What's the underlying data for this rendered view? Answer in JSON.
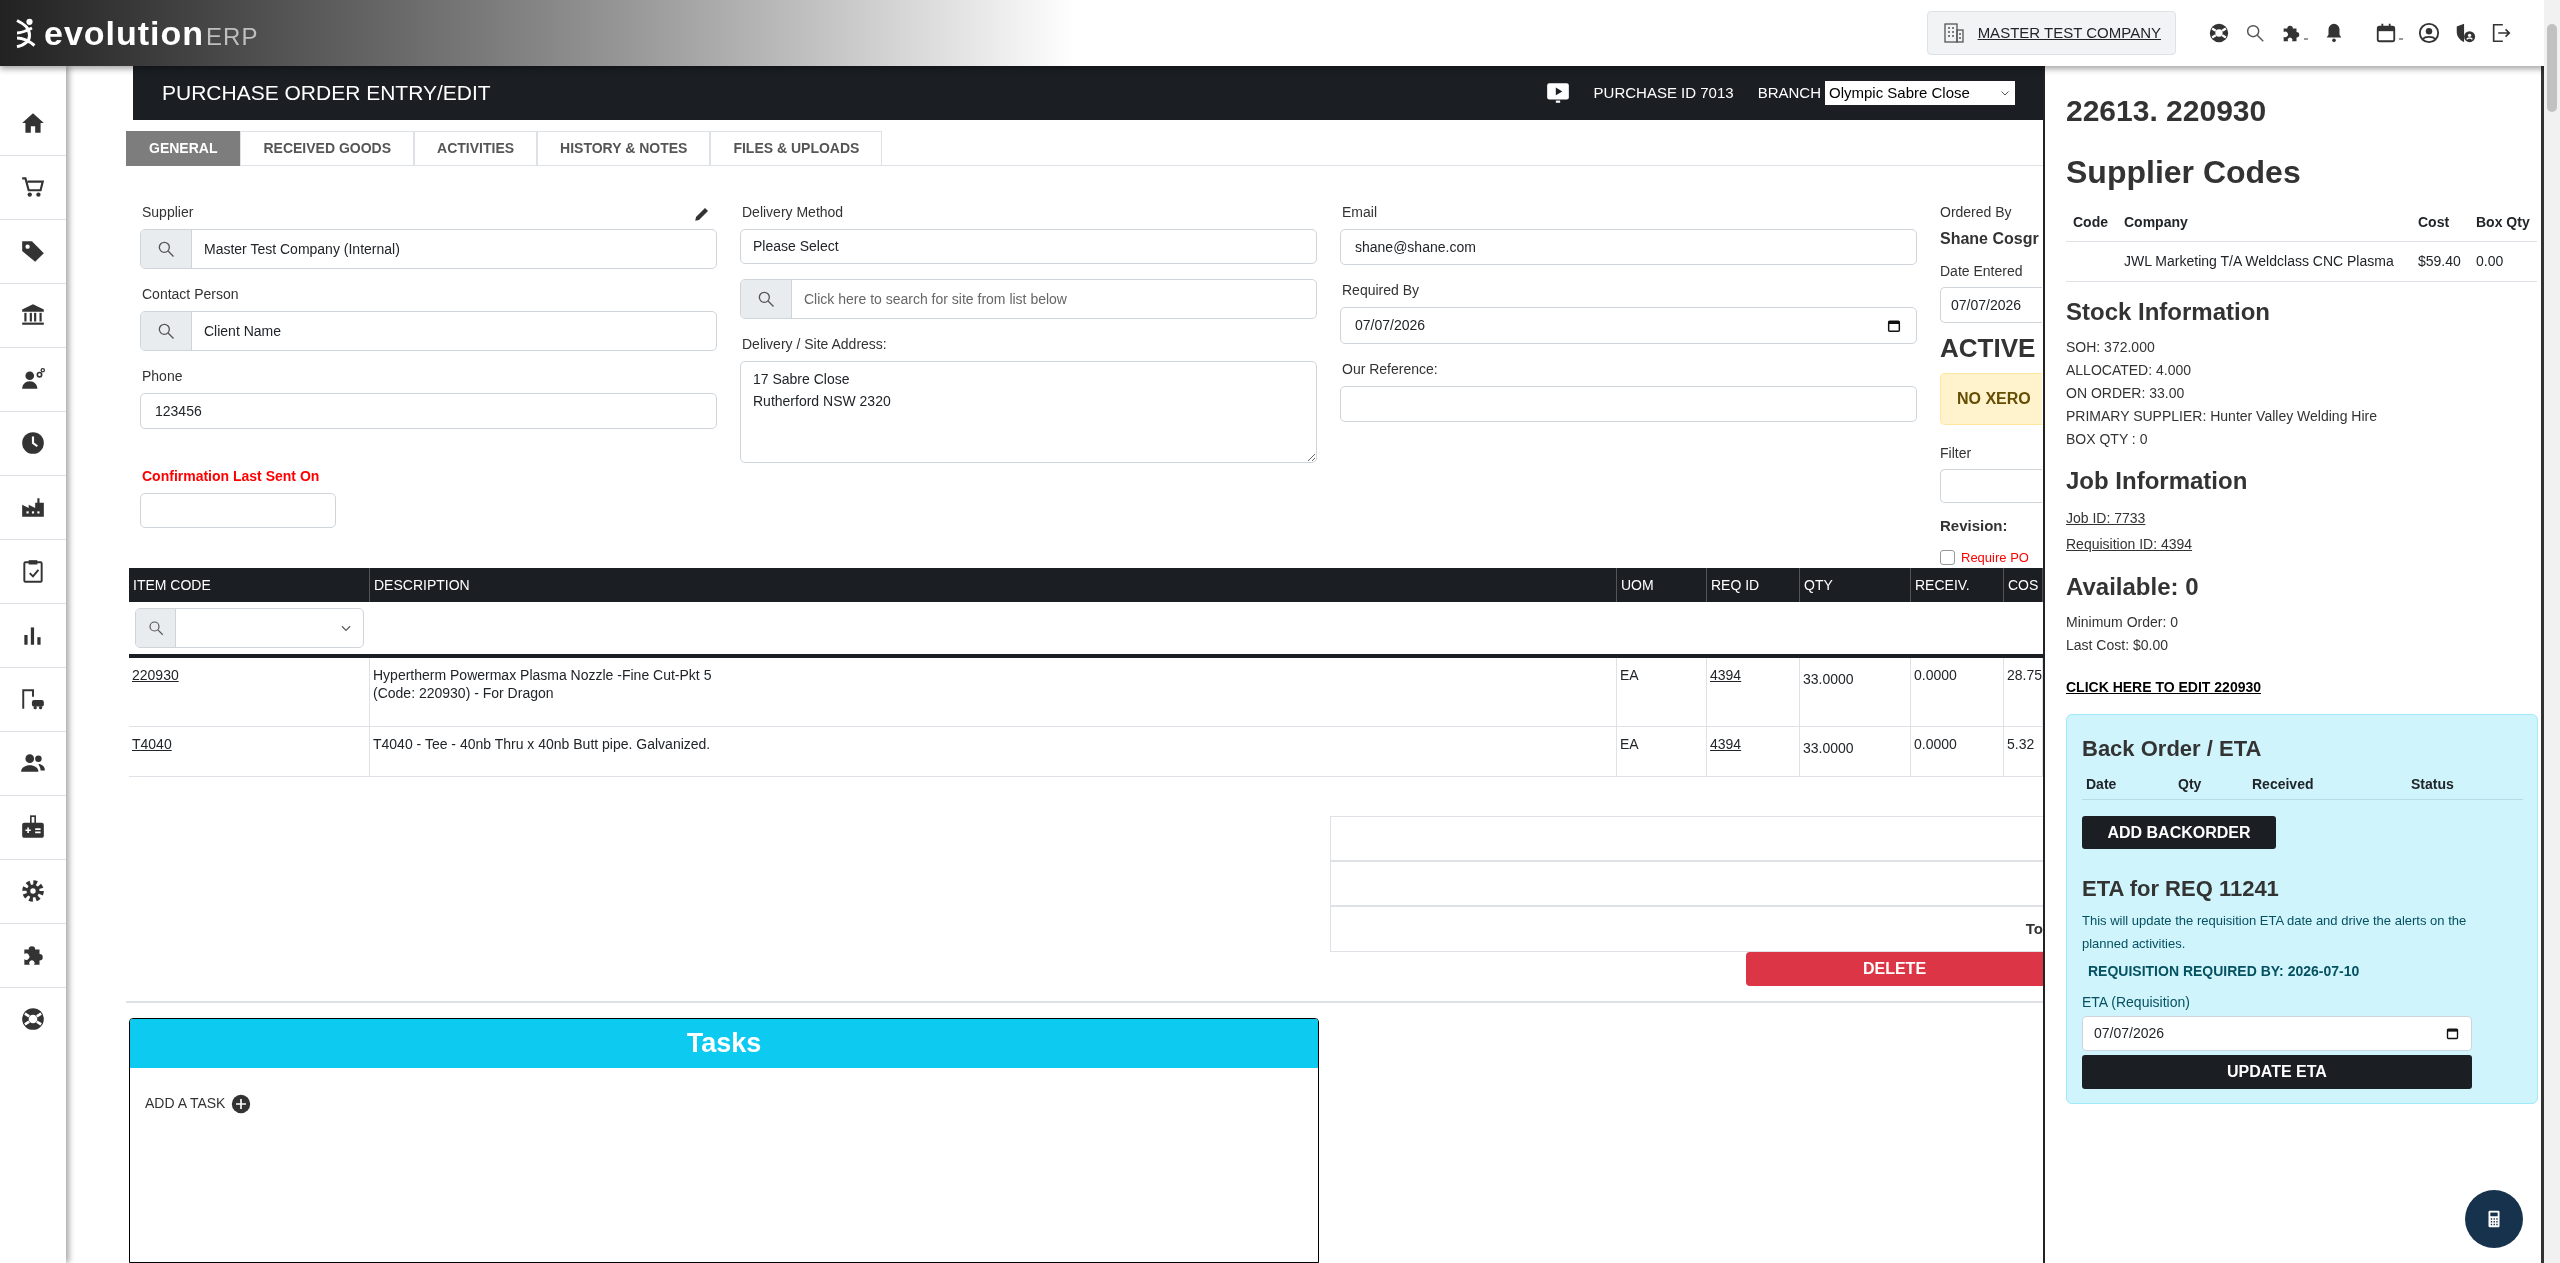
{
  "top_bar": {
    "brand": "evolution",
    "brand_suffix": "ERP",
    "company": "MASTER TEST COMPANY"
  },
  "header": {
    "title": "PURCHASE ORDER ENTRY/EDIT",
    "purchase_id": "PURCHASE ID 7013",
    "branch_label": "BRANCH",
    "branch": "Olympic Sabre Close"
  },
  "tabs": [
    {
      "label": "GENERAL",
      "selected": true
    },
    {
      "label": "RECEIVED GOODS",
      "selected": false
    },
    {
      "label": "ACTIVITIES",
      "selected": false
    },
    {
      "label": "HISTORY & NOTES",
      "selected": false
    },
    {
      "label": "FILES & UPLOADS",
      "selected": false
    }
  ],
  "form": {
    "columns": [
      [
        {
          "kind": "search",
          "label": "Supplier",
          "value": "Master Test Company (Internal)",
          "editable": true
        },
        {
          "kind": "search",
          "label": "Contact Person",
          "value": "Client Name"
        },
        {
          "kind": "text",
          "label": "Phone",
          "value": "123456"
        },
        {
          "kind": "short",
          "label": "Confirmation Last Sent On",
          "highlight": true
        }
      ],
      [
        {
          "kind": "select",
          "label": "Delivery Method",
          "value": "Please Select"
        },
        {
          "kind": "search",
          "placeholder": "Click here to search for site from list below"
        },
        {
          "kind": "textarea",
          "label": "Delivery / Site Address:",
          "value": "17 Sabre Close\nRutherford NSW 2320"
        }
      ],
      [
        {
          "kind": "text",
          "label": "Email",
          "value": "shane@shane.com"
        },
        {
          "kind": "date",
          "label": "Required By",
          "value": "07/07/2026"
        },
        {
          "kind": "text",
          "label": "Our Reference:"
        }
      ]
    ],
    "side": {
      "ordered_by_label": "Ordered By",
      "ordered_by": "Shane Cosgr",
      "date_entered_label": "Date Entered",
      "date_entered": "07/07/2026",
      "status": "ACTIVE",
      "xero_notice": "NO XERO",
      "filter_label": "Filter",
      "revision_label": "Revision:",
      "require_po": {
        "label": "Require PO",
        "checked": false
      }
    }
  },
  "lines": {
    "columns": [
      "ITEM CODE",
      "DESCRIPTION",
      "UOM",
      "REQ ID",
      "QTY",
      "RECEIV.",
      "COS"
    ],
    "rows": [
      {
        "item_code": "220930",
        "description": "Hypertherm Powermax Plasma Nozzle -Fine Cut-Pkt 5\n(Code: 220930) - For Dragon",
        "uom": "EA",
        "req_id": "4394",
        "qty": "33.0000",
        "received": "0.0000",
        "cost": "28.75"
      },
      {
        "item_code": "T4040",
        "description": "T4040 - Tee - 40nb Thru x 40nb Butt pipe. Galvanized.",
        "uom": "EA",
        "req_id": "4394",
        "qty": "33.0000",
        "received": "0.0000",
        "cost": "5.32"
      }
    ]
  },
  "totals": {
    "label": "To"
  },
  "delete_button": "DELETE",
  "tasks": {
    "title": "Tasks",
    "add_label": "ADD A TASK"
  },
  "drawer": {
    "title": "22613. 220930",
    "supplier_codes": {
      "heading": "Supplier Codes",
      "columns": [
        "Code",
        "Company",
        "Cost",
        "Box Qty"
      ],
      "rows": [
        {
          "company": "JWL Marketing T/A Weldclass CNC Plasma",
          "cost": "$59.40",
          "box_qty": "0.00"
        }
      ]
    },
    "stock": {
      "heading": "Stock Information",
      "lines": [
        "SOH: 372.000",
        "ALLOCATED: 4.000",
        "ON ORDER: 33.00",
        "PRIMARY SUPPLIER: Hunter Valley Welding Hire",
        "BOX QTY : 0"
      ]
    },
    "job": {
      "heading": "Job Information",
      "links": [
        "Job ID: 7733",
        "Requisition ID: 4394"
      ]
    },
    "available": {
      "heading": "Available: 0",
      "lines": [
        "Minimum Order: 0",
        "Last Cost: $0.00"
      ]
    },
    "edit_link": "CLICK HERE TO EDIT 220930",
    "backorder": {
      "heading": "Back Order / ETA",
      "columns": [
        "Date",
        "Qty",
        "Received",
        "Status"
      ],
      "add_button": "ADD BACKORDER",
      "eta_heading": "ETA for REQ 11241",
      "note": "This will update the requisition ETA date and drive the alerts on the planned activities.",
      "required_by": "REQUISITION REQUIRED BY: 2026-07-10",
      "eta_label": "ETA (Requisition)",
      "eta_value": "07/07/2026",
      "update_button": "UPDATE ETA"
    }
  }
}
